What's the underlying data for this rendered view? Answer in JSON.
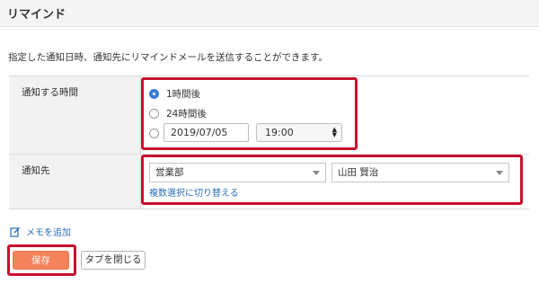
{
  "header": {
    "title": "リマインド"
  },
  "description": "指定した通知日時、通知先にリマインドメールを送信することができます。",
  "form": {
    "time_row": {
      "label": "通知する時間",
      "options": [
        {
          "label": "1時間後",
          "checked": true
        },
        {
          "label": "24時間後",
          "checked": false
        }
      ],
      "custom_option": {
        "checked": false,
        "date_value": "2019/07/05",
        "time_value": "19:00"
      }
    },
    "recipient_row": {
      "label": "通知先",
      "department": "営業部",
      "person": "山田 賢治",
      "switch_link": "複数選択に切り替える"
    }
  },
  "memo_link": "メモを追加",
  "buttons": {
    "save": "保存",
    "close_tab": "タブを閉じる"
  },
  "colors": {
    "highlight": "#c8102e",
    "accent": "#3b7bd9",
    "save_button": "#f4825a",
    "link": "#2a6fb5"
  }
}
